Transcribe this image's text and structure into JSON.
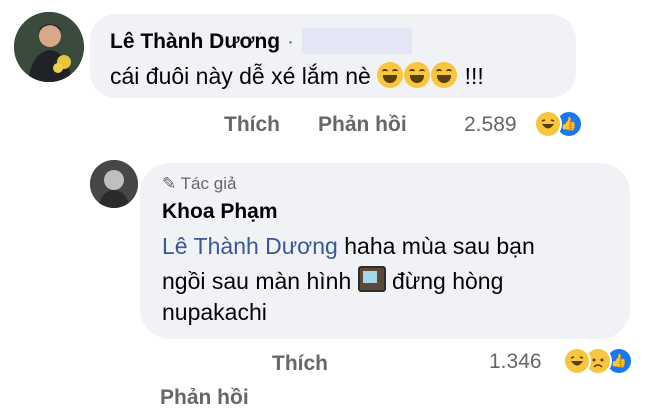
{
  "comment1": {
    "author": "Lê Thành Dương",
    "separator": "·",
    "text": "cái đuôi này dễ xé lắm nè",
    "emoji_suffix": "!!!",
    "emoji_names": [
      "laughing-emoji",
      "laughing-emoji",
      "laughing-emoji"
    ],
    "like_label": "Thích",
    "reply_label": "Phản hồi",
    "reaction_count": "2.589",
    "reactions": [
      "haha",
      "like"
    ]
  },
  "reply1": {
    "author_badge_label": "Tác giả",
    "author": "Khoa Phạm",
    "mention": "Lê Thành Dương",
    "text_line1": " haha mùa sau bạn",
    "text_line2a": "ngồi sau màn hình ",
    "text_line2b": " đừng hòng",
    "text_line3": "nupakachi",
    "like_label": "Thích",
    "reply_label": "Phản hồi",
    "reaction_count": "1.346",
    "reactions": [
      "haha",
      "sad",
      "like"
    ]
  },
  "colors": {
    "bubble": "#f0f2f5",
    "secondary_text": "#65676b",
    "mention": "#385898",
    "like_blue": "#1877f2",
    "emoji_yellow": "#f7c63d"
  }
}
